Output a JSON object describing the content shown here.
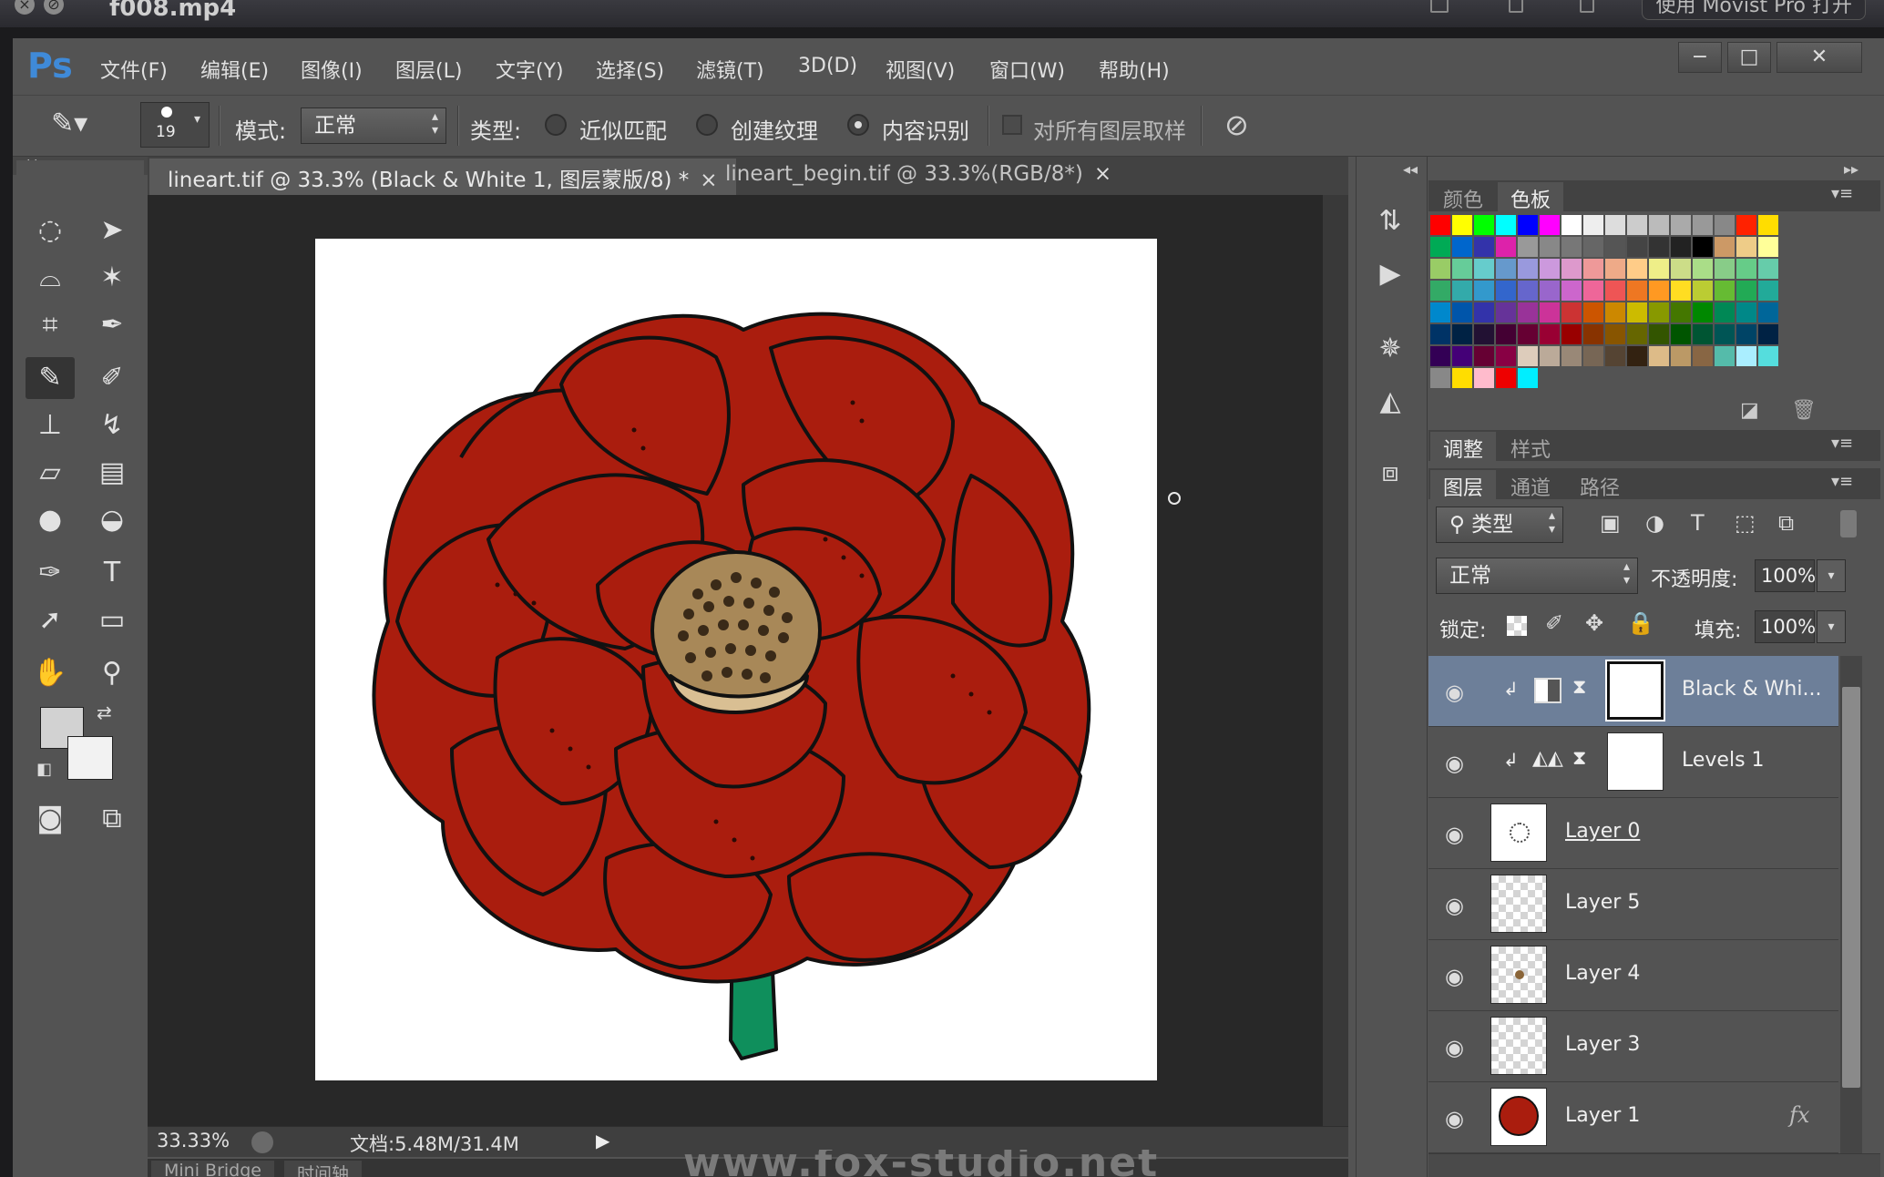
{
  "window": {
    "title": "f008.mp4",
    "open_with": "使用 Movist Pro 打开"
  },
  "app": {
    "logo": "Ps",
    "menus": [
      "文件(F)",
      "编辑(E)",
      "图像(I)",
      "图层(L)",
      "文字(Y)",
      "选择(S)",
      "滤镜(T)",
      "3D(D)",
      "视图(V)",
      "窗口(W)",
      "帮助(H)"
    ]
  },
  "options": {
    "brush_size": "19",
    "mode_label": "模式:",
    "mode_value": "正常",
    "type_label": "类型:",
    "radio_proximity": "近似匹配",
    "radio_texture": "创建纹理",
    "radio_content": "内容识别",
    "sample_all": "对所有图层取样"
  },
  "tabs": [
    {
      "label": "lineart.tif @ 33.3% (Black & White 1, 图层蒙版/8) *",
      "close": "×"
    },
    {
      "label": "lineart_begin.tif @ 33.3%(RGB/8*)",
      "close": "×"
    }
  ],
  "status": {
    "zoom": "33.33%",
    "doc": "文档:5.48M/31.4M"
  },
  "bottom_tabs": [
    "Mini Bridge",
    "时间轴"
  ],
  "watermark": "www.fox-studio.net",
  "panels": {
    "color_tabs": [
      "颜色",
      "色板"
    ],
    "adjust_tabs": [
      "调整",
      "样式"
    ],
    "layer_tabs": [
      "图层",
      "通道",
      "路径"
    ],
    "filter_kind": "类型",
    "blend_mode": "正常",
    "opacity_label": "不透明度:",
    "opacity_value": "100%",
    "lock_label": "锁定:",
    "fill_label": "填充:",
    "fill_value": "100%"
  },
  "layers": [
    {
      "name": "Black & Whi...",
      "kind": "adjust-bw",
      "active": true
    },
    {
      "name": "Levels 1",
      "kind": "adjust-levels",
      "active": false
    },
    {
      "name": "Layer 0",
      "kind": "pixel",
      "active": false
    },
    {
      "name": "Layer 5",
      "kind": "pixel",
      "active": false
    },
    {
      "name": "Layer 4",
      "kind": "pixel",
      "active": false
    },
    {
      "name": "Layer 3",
      "kind": "pixel",
      "active": false
    },
    {
      "name": "Layer 1",
      "kind": "pixel",
      "fx": "fx",
      "active": false
    }
  ],
  "colors": {
    "ps_blue": "#3f8ad8",
    "flower_red": "#aa1d0e",
    "stem_green": "#0f8f5c",
    "center_brown": "#a88858",
    "selected_layer": "#6d7f99"
  }
}
